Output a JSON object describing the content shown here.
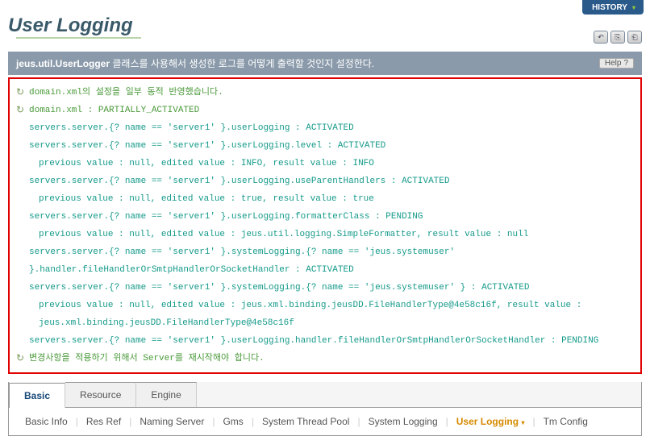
{
  "header": {
    "history": "HISTORY"
  },
  "title": "User Logging",
  "desc": {
    "class": "jeus.util.UserLogger",
    "text": " 클래스를 사용해서 생성한 로그를 어떻게 출력할 것인지 설정한다.",
    "help": "Help"
  },
  "log": {
    "l1": "domain.xml의 설정을 일부 동적 반영했습니다.",
    "l2": "domain.xml : PARTIALLY_ACTIVATED",
    "l3": "servers.server.{? name == 'server1' }.userLogging : ACTIVATED",
    "l4": "servers.server.{? name == 'server1' }.userLogging.level : ACTIVATED",
    "l5": "previous value : null, edited value : INFO, result value : INFO",
    "l6": "servers.server.{? name == 'server1' }.userLogging.useParentHandlers : ACTIVATED",
    "l7": "previous value : null, edited value : true, result value : true",
    "l8": "servers.server.{? name == 'server1' }.userLogging.formatterClass : PENDING",
    "l9": "previous value : null, edited value : jeus.util.logging.SimpleFormatter, result value : null",
    "l10": "servers.server.{? name == 'server1' }.systemLogging.{? name == 'jeus.systemuser' }.handler.fileHandlerOrSmtpHandlerOrSocketHandler : ACTIVATED",
    "l11": "servers.server.{? name == 'server1' }.systemLogging.{? name == 'jeus.systemuser' } : ACTIVATED",
    "l12": "previous value : null, edited value : jeus.xml.binding.jeusDD.FileHandlerType@4e58c16f, result value : jeus.xml.binding.jeusDD.FileHandlerType@4e58c16f",
    "l13": "servers.server.{? name == 'server1' }.userLogging.handler.fileHandlerOrSmtpHandlerOrSocketHandler : PENDING",
    "l14": "변경사항을 적용하기 위해서 Server를 재시작해야 합니다."
  },
  "tabs": {
    "t1": "Basic",
    "t2": "Resource",
    "t3": "Engine"
  },
  "subnav": {
    "s1": "Basic Info",
    "s2": "Res Ref",
    "s3": "Naming Server",
    "s4": "Gms",
    "s5": "System Thread Pool",
    "s6": "System Logging",
    "s7": "User Logging",
    "s8": "Tm Config"
  },
  "icons": {
    "i1": "↶",
    "i2": "⎘",
    "i3": "⎗"
  }
}
